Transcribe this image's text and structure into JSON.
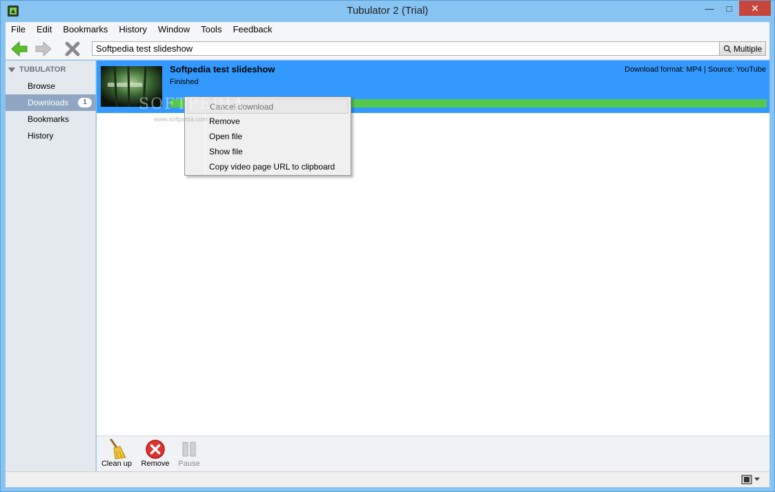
{
  "window": {
    "title": "Tubulator 2 (Trial)",
    "minimize": "—",
    "maximize": "□",
    "close": "✕"
  },
  "menubar": {
    "items": [
      "File",
      "Edit",
      "Bookmarks",
      "History",
      "Window",
      "Tools",
      "Feedback"
    ]
  },
  "toolbar": {
    "url_value": "Softpedia test slideshow",
    "multiple_label": "Multiple",
    "back_icon": "back-arrow-icon",
    "forward_icon": "forward-arrow-icon",
    "stop_icon": "stop-icon"
  },
  "sidebar": {
    "header": "TUBULATOR",
    "items": [
      {
        "label": "Browse"
      },
      {
        "label": "Downloads",
        "badge": "1"
      },
      {
        "label": "Bookmarks"
      },
      {
        "label": "History"
      }
    ]
  },
  "download": {
    "title": "Softpedia test slideshow",
    "status": "Finished",
    "info": "Download format: MP4 | Source: YouTube",
    "progress": 1.0,
    "accent": "#3399ff",
    "progress_color": "#54c84d"
  },
  "context_menu": {
    "items": [
      {
        "label": "Cancel download",
        "disabled": true
      },
      {
        "label": "Remove"
      },
      {
        "label": "Open file"
      },
      {
        "label": "Show file"
      },
      {
        "label": "Copy video page URL to clipboard"
      }
    ]
  },
  "bottom_bar": {
    "cleanup_label": "Clean up",
    "remove_label": "Remove",
    "pause_label": "Pause"
  },
  "watermark": {
    "main": "SOFTPEDIA",
    "sub": "www.softpedia.com"
  }
}
